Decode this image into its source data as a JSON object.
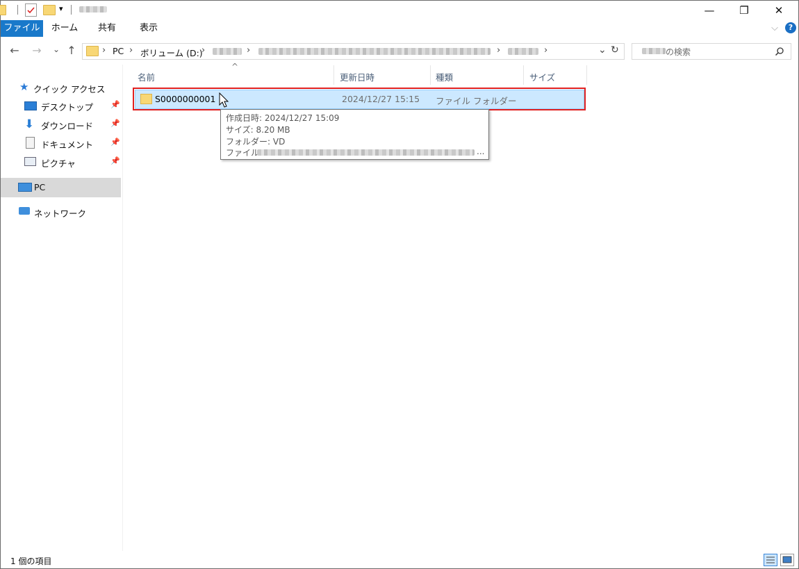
{
  "titlebar": {
    "title": "",
    "minimize": "—",
    "restore": "❐",
    "close": "✕"
  },
  "ribbon": {
    "tabs": [
      "ファイル",
      "ホーム",
      "共有",
      "表示"
    ],
    "expand": "⌵",
    "help": "?"
  },
  "address": {
    "back": "←",
    "forward": "→",
    "recent": "⌄",
    "up": "↑",
    "crumbs": [
      "PC",
      "ボリューム (D:)"
    ],
    "dropdown": "⌄",
    "refresh": "↻",
    "search_placeholder": "の検索",
    "search_icon": "magnifier-icon"
  },
  "navpane": {
    "quick_access": "クイック アクセス",
    "items": [
      {
        "label": "デスクトップ",
        "icon": "desktop-icon",
        "pinned": true
      },
      {
        "label": "ダウンロード",
        "icon": "download-icon",
        "pinned": true
      },
      {
        "label": "ドキュメント",
        "icon": "document-icon",
        "pinned": true
      },
      {
        "label": "ピクチャ",
        "icon": "pictures-icon",
        "pinned": true
      }
    ],
    "pc": "PC",
    "network": "ネットワーク"
  },
  "columns": {
    "name": "名前",
    "date": "更新日時",
    "type": "種類",
    "size": "サイズ",
    "sort_indicator": "^"
  },
  "files": [
    {
      "name": "S0000000001",
      "date": "2024/12/27 15:15",
      "type": "ファイル フォルダー",
      "size": ""
    }
  ],
  "tooltip": {
    "created": "作成日時: 2024/12/27 15:09",
    "size": "サイズ: 8.20 MB",
    "folders": "フォルダー: VD",
    "files_prefix": "ファイル:",
    "files_ellipsis": "..."
  },
  "status": {
    "count": "1 個の項目"
  },
  "colors": {
    "accent": "#1979ca",
    "selection": "#cce8ff",
    "highlight_box": "#e02020"
  }
}
